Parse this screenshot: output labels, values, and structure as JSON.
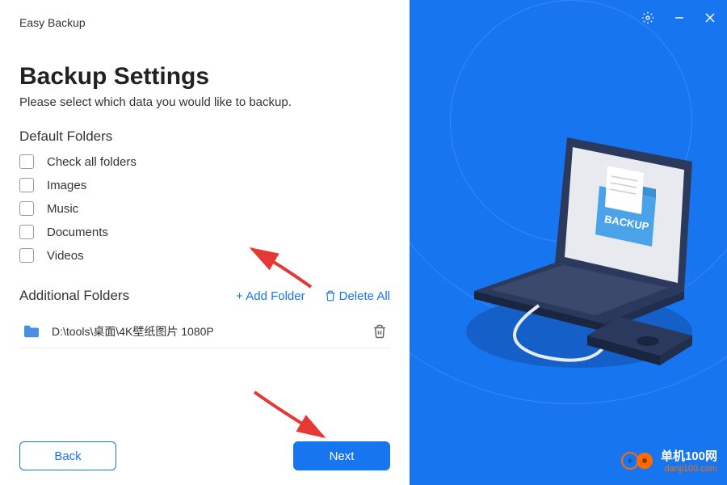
{
  "app_title": "Easy Backup",
  "page_title": "Backup Settings",
  "page_subtitle": "Please select which data you would like to backup.",
  "default_folders_title": "Default Folders",
  "check_all_label": "Check all folders",
  "folders": {
    "images": "Images",
    "documents": "Documents",
    "music": "Music",
    "videos": "Videos"
  },
  "additional_title": "Additional Folders",
  "add_folder_label": "+ Add Folder",
  "delete_all_label": "Delete All",
  "folder_list": [
    {
      "path": "D:\\tools\\桌面\\4K壁纸图片 1080P"
    }
  ],
  "back_label": "Back",
  "next_label": "Next",
  "watermark": {
    "main": "单机100网",
    "sub": "danji100.com"
  },
  "illustration_label": "BACKUP"
}
